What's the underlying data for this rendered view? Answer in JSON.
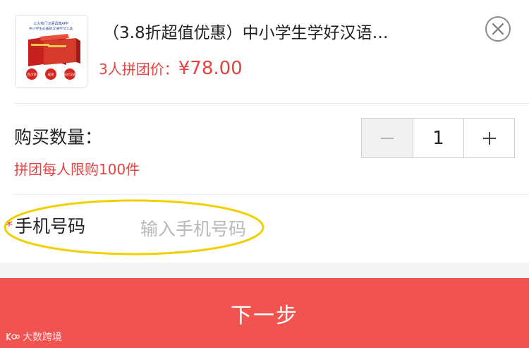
{
  "product": {
    "title": "（3.8折超值优惠）中小学生学好汉语…",
    "price_label": "3人拼团价：",
    "price_value": "¥78.00",
    "thumbnail": {
      "line1": "三大热门汉语词典APP",
      "line2": "中小学生必备的汉语学习工具",
      "badges": [
        "古汉语",
        "成语",
        "现代汉语"
      ]
    }
  },
  "quantity": {
    "label": "购买数量：",
    "value": "1",
    "minus_symbol": "−",
    "plus_symbol": "+",
    "limit_text": "拼团每人限购100件"
  },
  "phone": {
    "required_mark": "*",
    "label": "手机号码",
    "placeholder": "输入手机号码",
    "value": ""
  },
  "footer": {
    "next_label": "下一步"
  },
  "watermark": {
    "text": "大数跨境"
  },
  "colors": {
    "accent": "#e64340",
    "button": "#f05350",
    "highlight_ellipse": "#f0d000"
  },
  "icons": {
    "close": "close-circle-icon"
  }
}
